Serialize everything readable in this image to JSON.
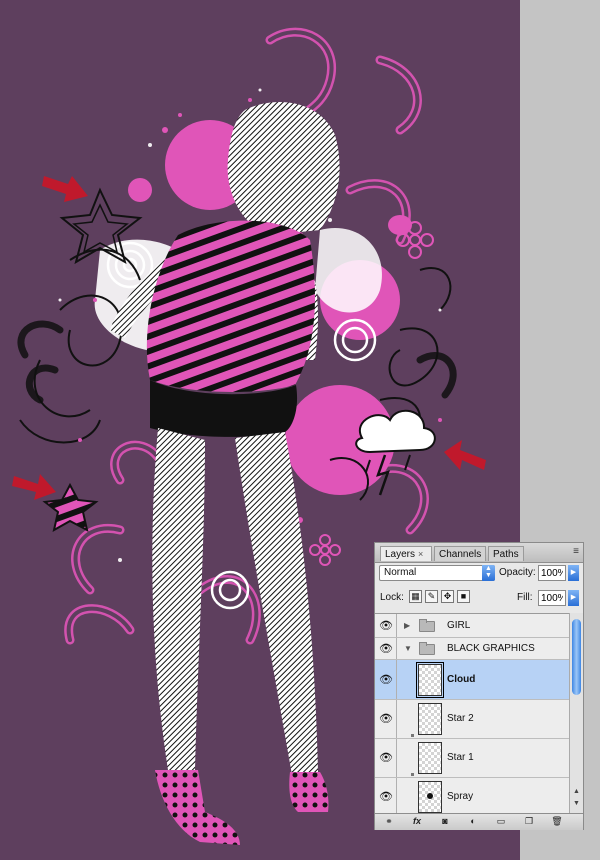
{
  "layers_panel": {
    "tabs": [
      {
        "label": "Layers",
        "close": "×"
      },
      {
        "label": "Channels"
      },
      {
        "label": "Paths"
      }
    ],
    "panel_menu_icon": "≡",
    "blend_mode": "Normal",
    "opacity_label": "Opacity:",
    "opacity_value": "100%",
    "lock_label": "Lock:",
    "fill_label": "Fill:",
    "fill_value": "100%",
    "layers": [
      {
        "name": "GIRL",
        "type": "group",
        "expanded": false
      },
      {
        "name": "BLACK GRAPHICS",
        "type": "group",
        "expanded": true
      },
      {
        "name": "Cloud",
        "type": "layer",
        "selected": true
      },
      {
        "name": "Star 2",
        "type": "layer"
      },
      {
        "name": "Star 1",
        "type": "layer"
      },
      {
        "name": "Spray",
        "type": "layer"
      }
    ],
    "bottom_icons": [
      "link-icon",
      "fx-icon",
      "mask-icon",
      "adjustment-icon",
      "new-group-icon",
      "new-layer-icon",
      "trash-icon"
    ],
    "fx_label": "fx"
  },
  "colors": {
    "canvas_bg": "#5e3f5e",
    "pink": "#e055b8",
    "red_arrow": "#c0192c",
    "selection": "#b7d2f5"
  }
}
